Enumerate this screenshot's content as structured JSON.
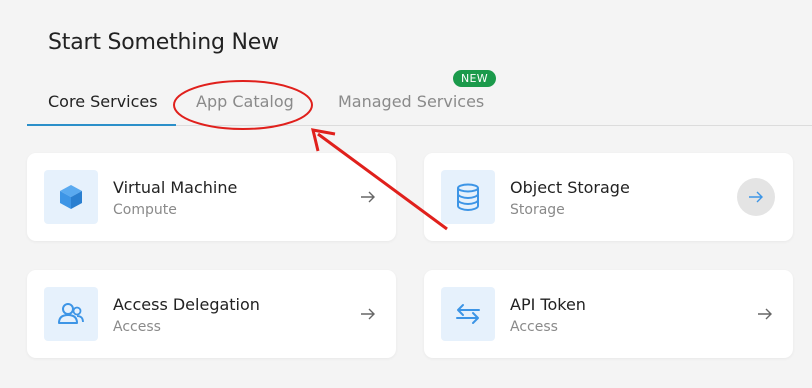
{
  "page": {
    "title": "Start Something New"
  },
  "tabs": [
    {
      "label": "Core Services",
      "active": true
    },
    {
      "label": "App Catalog",
      "active": false
    },
    {
      "label": "Managed Services",
      "active": false,
      "badge": "NEW"
    }
  ],
  "cards": [
    {
      "title": "Virtual Machine",
      "subtitle": "Compute",
      "icon": "cube-icon"
    },
    {
      "title": "Object Storage",
      "subtitle": "Storage",
      "icon": "database-icon"
    },
    {
      "title": "Access Delegation",
      "subtitle": "Access",
      "icon": "users-icon"
    },
    {
      "title": "API Token",
      "subtitle": "Access",
      "icon": "swap-arrows-icon"
    }
  ],
  "colors": {
    "accent": "#2b8fc9",
    "icon_blue": "#3d95e6",
    "badge_green": "#1b9a4b",
    "annotation_red": "#e0201c"
  }
}
